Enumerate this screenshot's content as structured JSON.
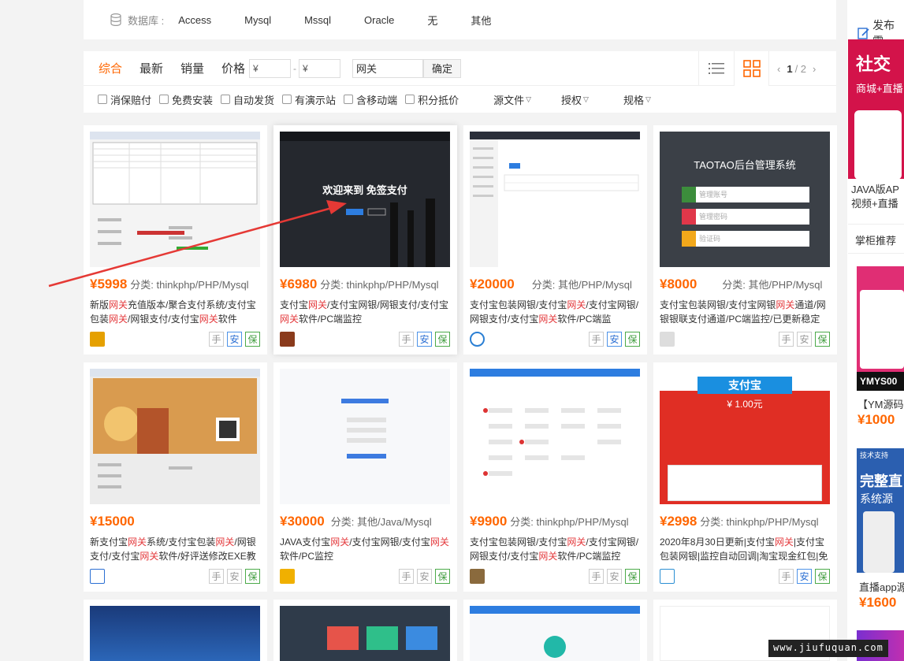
{
  "db_filter": {
    "label": "数据库 :",
    "options": [
      "Access",
      "Mysql",
      "Mssql",
      "Oracle",
      "无",
      "其他"
    ]
  },
  "toolbar": {
    "sorts": [
      "综合",
      "最新",
      "销量",
      "价格"
    ],
    "price_min_placeholder": "¥",
    "price_max_placeholder": "¥",
    "price_sep": "-",
    "keyword": "网关",
    "confirm": "确定",
    "page_current": "1",
    "page_total": "/ 2"
  },
  "filters": {
    "checks": [
      "消保赔付",
      "免费安装",
      "自动发货",
      "有演示站",
      "含移动端",
      "积分抵价"
    ],
    "dropdowns": [
      "源文件",
      "授权",
      "规格"
    ]
  },
  "products": [
    {
      "price": "¥5998",
      "cat": "分类: thinkphp/PHP/Mysql",
      "title": [
        "新版",
        "网关",
        "充值版本/聚合支付系统/支付宝包装",
        "网关",
        "/网银支付/支付宝",
        "网关",
        "软件"
      ],
      "badges": [
        "手",
        "安",
        "保"
      ]
    },
    {
      "price": "¥6980",
      "cat": "分类: thinkphp/PHP/Mysql",
      "title": [
        "支付宝",
        "网关",
        "/支付宝网银/网银支付/支付宝",
        "网关",
        "软件/PC端监控"
      ],
      "badges": [
        "手",
        "安",
        "保"
      ],
      "thumb_text": "欢迎来到 免签支付"
    },
    {
      "price": "¥20000",
      "cat": "分类: 其他/PHP/Mysql",
      "title": [
        "支付宝包装网银/支付宝",
        "网关",
        "/支付宝网银/网银支付/支付宝",
        "网关",
        "软件/PC端监"
      ],
      "badges": [
        "手",
        "安",
        "保"
      ]
    },
    {
      "price": "¥8000",
      "cat": "分类: 其他/PHP/Mysql",
      "title": [
        "支付宝包装网银/支付宝网银",
        "网关",
        "通道/网银银联支付通道/PC端监控/已更新稳定"
      ],
      "badges": [
        "手",
        "安",
        "保"
      ],
      "thumb_text": "TAOTAO后台管理系统",
      "fields": [
        "管理账号",
        "管理密码",
        "验证码"
      ]
    },
    {
      "price": "¥15000",
      "cat": "",
      "title": [
        "新支付宝",
        "网关",
        "系统/支付宝包装",
        "网关",
        "/网银支付/支付宝",
        "网关",
        "软件/好评送修改EXE教"
      ],
      "badges": [
        "手",
        "安",
        "保"
      ]
    },
    {
      "price": "¥30000",
      "cat": "分类: 其他/Java/Mysql",
      "title": [
        "JAVA支付宝",
        "网关",
        "/支付宝网银/支付宝",
        "网关",
        "软件/PC监控"
      ],
      "badges": [
        "手",
        "安",
        "保"
      ]
    },
    {
      "price": "¥9900",
      "cat": "分类: thinkphp/PHP/Mysql",
      "title": [
        "支付宝包装网银/支付宝",
        "网关",
        "/支付宝网银/网银支付/支付宝",
        "网关",
        "软件/PC端监控"
      ],
      "badges": [
        "手",
        "安",
        "保"
      ]
    },
    {
      "price": "¥2998",
      "cat": "分类: thinkphp/PHP/Mysql",
      "title": [
        "2020年8月30日更新|支付宝",
        "网关",
        "|支付宝包装网银|监控自动回调|淘宝现金红包|免"
      ],
      "badges": [
        "手",
        "安",
        "保"
      ],
      "thumb_text": "支付宝",
      "thumb_amount": "¥ 1.00元"
    }
  ],
  "sidebar": {
    "publish": "发布需",
    "ad_title": "社交",
    "ad_sub": "商城+直播",
    "ad_caption_1": "JAVA版AP",
    "ad_caption_2": "视频+直播",
    "recommend": "掌柜推荐",
    "item1_code": "YMYS00",
    "item1_title": "【YM源码",
    "item1_price": "¥1000",
    "item2_title": "直播app源",
    "item2_price": "¥1600",
    "item2_badge": "技术支持",
    "item2_big": "完整直",
    "item2_sub": "系统源"
  },
  "watermark": "www.jiufuquan.com",
  "colors": {
    "accent": "#ff6600",
    "highlight": "#e4393c"
  }
}
